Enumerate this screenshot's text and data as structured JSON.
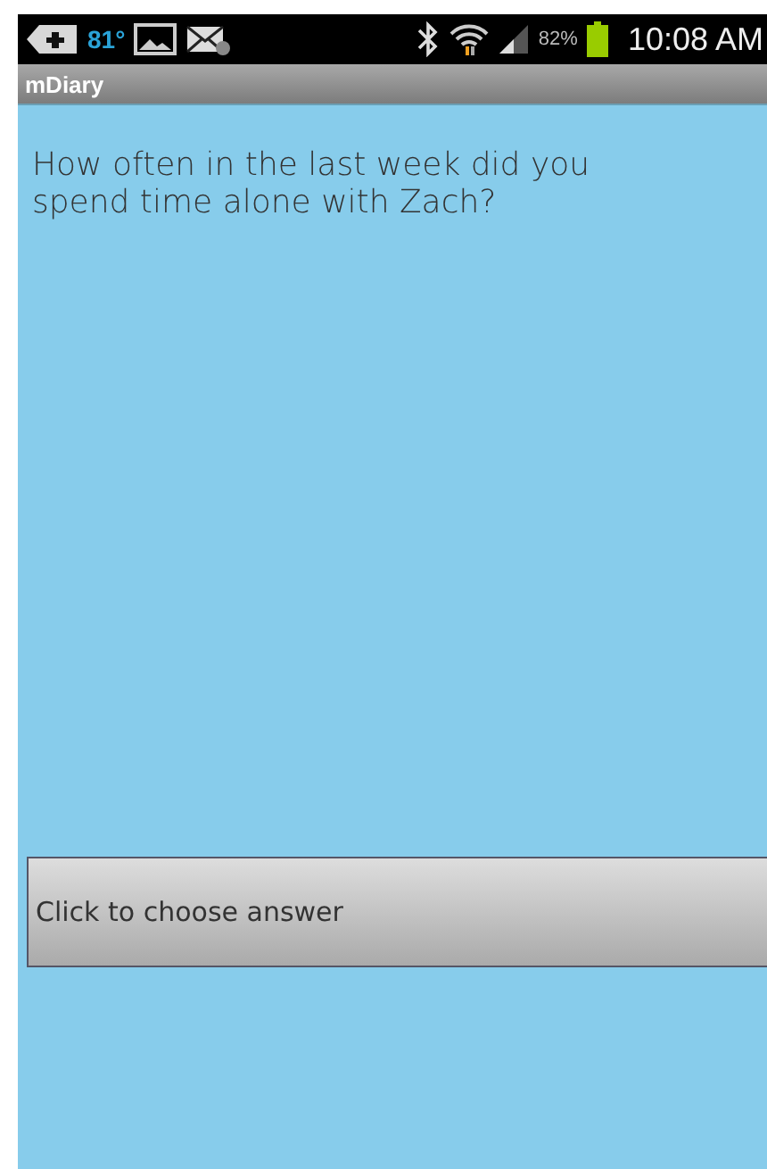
{
  "status_bar": {
    "temperature": "81°",
    "battery": "82%",
    "time": "10:08 AM"
  },
  "app_bar": {
    "title": "mDiary"
  },
  "question": "How often in the last week did you spend time alone with Zach?",
  "answer_button": {
    "label": "Click to choose answer"
  }
}
